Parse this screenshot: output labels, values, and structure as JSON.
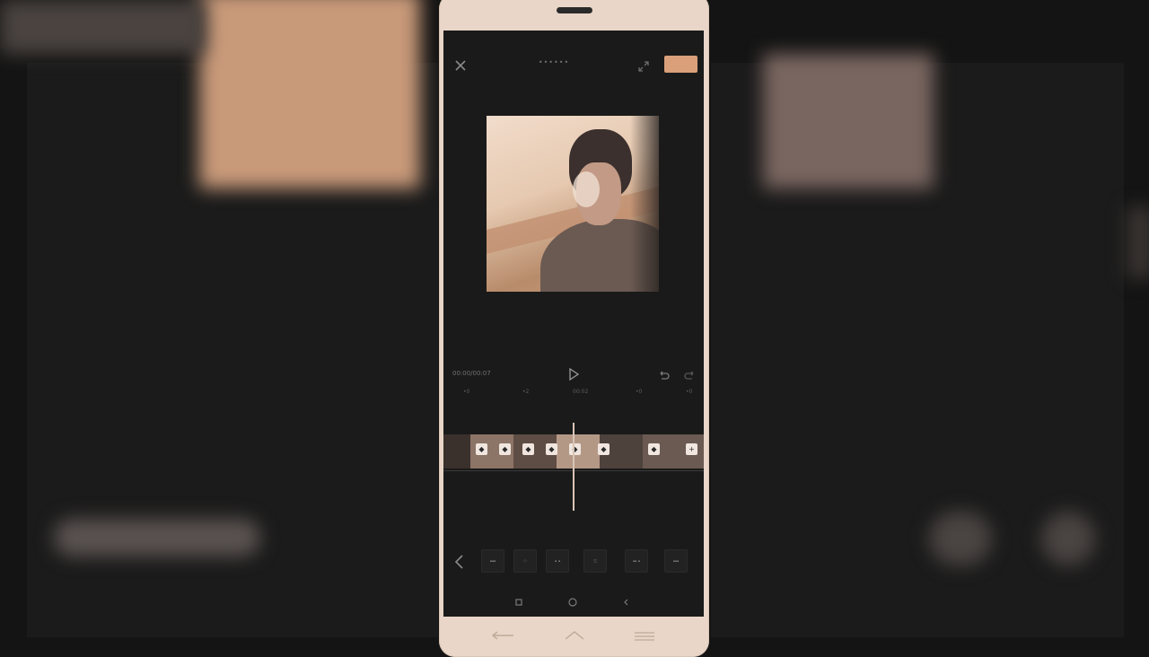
{
  "editor": {
    "title": "••••••",
    "export_label": "",
    "timecode": "00:00/00:07",
    "ruler_ticks": [
      "•0",
      "•2",
      "00:02",
      "•0",
      "•0"
    ],
    "markers": [
      "◆",
      "◆",
      "◆",
      "◆",
      "◆",
      "◆",
      "◆",
      "+"
    ],
    "tools": [
      "▪▪▪",
      "⁘",
      "▪ ▪",
      "⁝⁝",
      "▪▪ ▪",
      "▪▪▪"
    ]
  },
  "colors": {
    "accent": "#d9a07a",
    "background": "#1a1a1a",
    "phone_body": "#e9d6c8"
  },
  "icons": {
    "close": "close-icon",
    "expand": "expand-icon",
    "play": "play-icon",
    "undo": "undo-icon",
    "redo": "redo-icon"
  }
}
